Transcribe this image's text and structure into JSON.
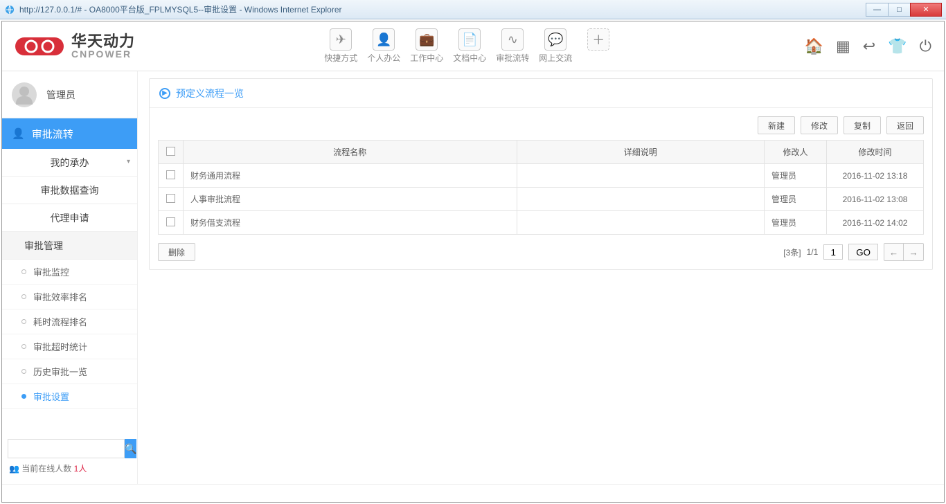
{
  "window": {
    "title": "http://127.0.0.1/# - OA8000平台版_FPLMYSQL5--审批设置 - Windows Internet Explorer"
  },
  "logo": {
    "cn": "华天动力",
    "en": "CNPOWER"
  },
  "topnav": [
    {
      "label": "快捷方式"
    },
    {
      "label": "个人办公"
    },
    {
      "label": "工作中心"
    },
    {
      "label": "文档中心"
    },
    {
      "label": "审批流转"
    },
    {
      "label": "网上交流"
    }
  ],
  "user": {
    "name": "管理员"
  },
  "sidebar": {
    "section": "审批流转",
    "items": [
      {
        "label": "我的承办"
      },
      {
        "label": "审批数据查询"
      },
      {
        "label": "代理申请"
      }
    ],
    "group": "审批管理",
    "subitems": [
      {
        "label": "审批监控"
      },
      {
        "label": "审批效率排名"
      },
      {
        "label": "耗时流程排名"
      },
      {
        "label": "审批超时统计"
      },
      {
        "label": "历史审批一览"
      },
      {
        "label": "审批设置",
        "active": true
      }
    ]
  },
  "online": {
    "label": "当前在线人数",
    "count": "1人"
  },
  "panel": {
    "title": "预定义流程一览"
  },
  "toolbar": {
    "new": "新建",
    "edit": "修改",
    "copy": "复制",
    "back": "返回"
  },
  "table": {
    "headers": {
      "name": "流程名称",
      "desc": "详细说明",
      "modifier": "修改人",
      "time": "修改时间"
    },
    "rows": [
      {
        "name": "财务通用流程",
        "desc": "",
        "modifier": "管理员",
        "time": "2016-11-02 13:18"
      },
      {
        "name": "人事审批流程",
        "desc": "",
        "modifier": "管理员",
        "time": "2016-11-02 13:08"
      },
      {
        "name": "财务借支流程",
        "desc": "",
        "modifier": "管理员",
        "time": "2016-11-02 14:02"
      }
    ]
  },
  "footer": {
    "delete": "删除",
    "count": "[3条]",
    "page": "1/1",
    "input": "1",
    "go": "GO"
  }
}
